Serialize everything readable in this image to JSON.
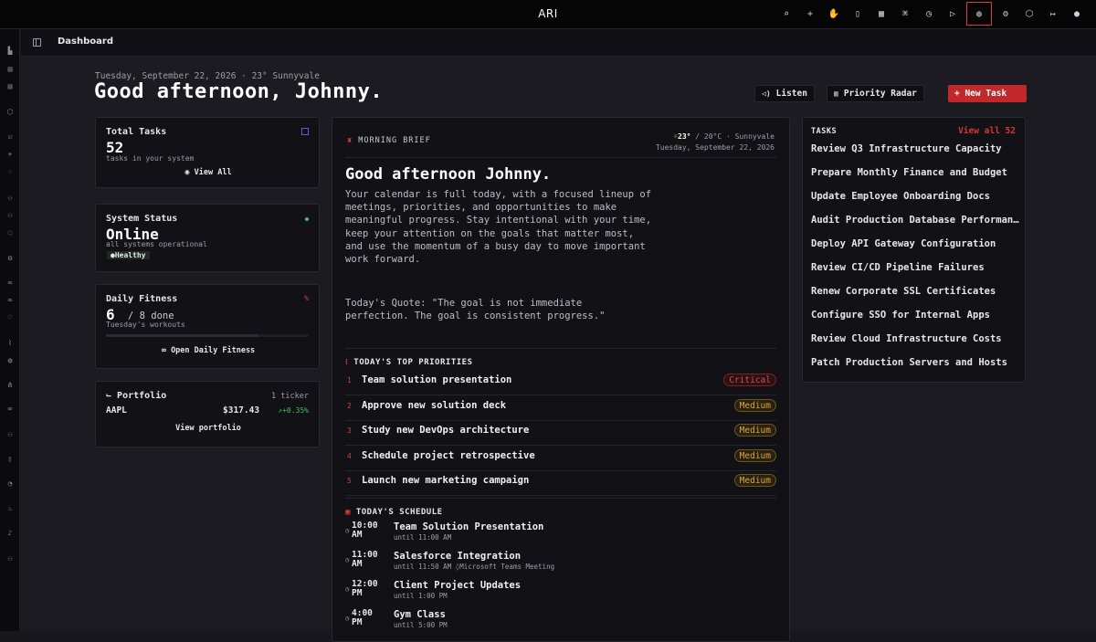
{
  "app": {
    "title": "ARI"
  },
  "topbar": {
    "icons": [
      "search-icon",
      "plus-icon",
      "hand-icon",
      "file-icon",
      "calendar-grid-icon",
      "command-icon",
      "clock-icon",
      "play-icon",
      "palette-icon",
      "gear-icon",
      "cube-icon",
      "logout-icon",
      "user-icon"
    ],
    "active_icon": "palette-icon"
  },
  "sidebar": {
    "icons": [
      "chart-icon",
      "database-icon",
      "calendar-icon",
      "cube-icon",
      "check-icon",
      "rocket-icon",
      "bell-icon",
      "users-icon",
      "team-icon",
      "chat-icon",
      "robot-icon",
      "link-icon",
      "link2-icon",
      "heart-icon",
      "trend-icon",
      "globe-icon",
      "network-icon",
      "group-icon",
      "person-icon",
      "book-icon",
      "gauge-icon",
      "flame-icon",
      "music-icon",
      "people-icon"
    ]
  },
  "breadcrumb": {
    "label": "Dashboard"
  },
  "header": {
    "date_line": "Tuesday, September 22, 2026 · 23° Sunnyvale",
    "greeting": "Good afternoon, Johnny.",
    "listen_label": "Listen",
    "radar_label": "Priority Radar",
    "new_task_label": "+ New Task"
  },
  "total_tasks": {
    "title": "Total Tasks",
    "count": "52",
    "sub": "tasks in your system",
    "link": "View All"
  },
  "system_status": {
    "title": "System Status",
    "value": "Online",
    "sub": "all systems operational",
    "badge": "●Healthy",
    "status_color": "#3fbf5f"
  },
  "fitness": {
    "title": "Daily Fitness",
    "count": "6",
    "suffix": "/ 8 done",
    "sub": "Tuesday's workouts",
    "link": "Open Daily Fitness",
    "progress": 0.75
  },
  "portfolio": {
    "title": "Portfolio",
    "count": "1 ticker",
    "ticker": "AAPL",
    "price": "$317.43",
    "change": "↗+0.35%",
    "link": "View portfolio",
    "change_color": "#3fbf5f"
  },
  "brief": {
    "label": "MORNING BRIEF",
    "temp": "23°",
    "temp_c": "/ 20°C · Sunnyvale",
    "date": "Tuesday, September 22, 2026",
    "title": "Good afternoon Johnny.",
    "body": "Your calendar is full today, with a focused lineup of meetings, priorities, and opportunities to make meaningful progress. Stay intentional with your time, keep your attention on the goals that matter most, and use the momentum of a busy day to move important work forward.",
    "quote": "Today's Quote: \"The goal is not immediate perfection. The goal is consistent progress.\"",
    "priorities_title": "TODAY'S TOP PRIORITIES",
    "priorities": [
      {
        "num": "1",
        "label": "Team solution presentation",
        "level": "Critical"
      },
      {
        "num": "2",
        "label": "Approve new solution deck",
        "level": "Medium"
      },
      {
        "num": "3",
        "label": "Study new DevOps architecture",
        "level": "Medium"
      },
      {
        "num": "4",
        "label": "Schedule project retrospective",
        "level": "Medium"
      },
      {
        "num": "5",
        "label": "Launch new marketing campaign",
        "level": "Medium"
      }
    ],
    "schedule_title": "TODAY'S SCHEDULE",
    "schedule": [
      {
        "time": "10:00",
        "ampm": "AM",
        "title": "Team Solution Presentation",
        "sub": "until 11:00 AM"
      },
      {
        "time": "11:00",
        "ampm": "AM",
        "title": "Salesforce Integration",
        "sub": "until 11:50 AM  ◊Microsoft Teams Meeting"
      },
      {
        "time": "12:00",
        "ampm": "PM",
        "title": "Client Project Updates",
        "sub": "until 1:00 PM"
      },
      {
        "time": "4:00",
        "ampm": "PM",
        "title": "Gym Class",
        "sub": "until 5:00 PM"
      }
    ]
  },
  "tasks_panel": {
    "title": "TASKS",
    "view_all": "View all 52",
    "items": [
      "Review Q3 Infrastructure Capacity",
      "Prepare Monthly Finance and Budget",
      "Update Employee Onboarding Docs",
      "Audit Production Database Performance",
      "Deploy API Gateway Configuration",
      "Review CI/CD Pipeline Failures",
      "Renew Corporate SSL Certificates",
      "Configure SSO for Internal Apps",
      "Review Cloud Infrastructure Costs",
      "Patch Production Servers and Hosts"
    ]
  }
}
